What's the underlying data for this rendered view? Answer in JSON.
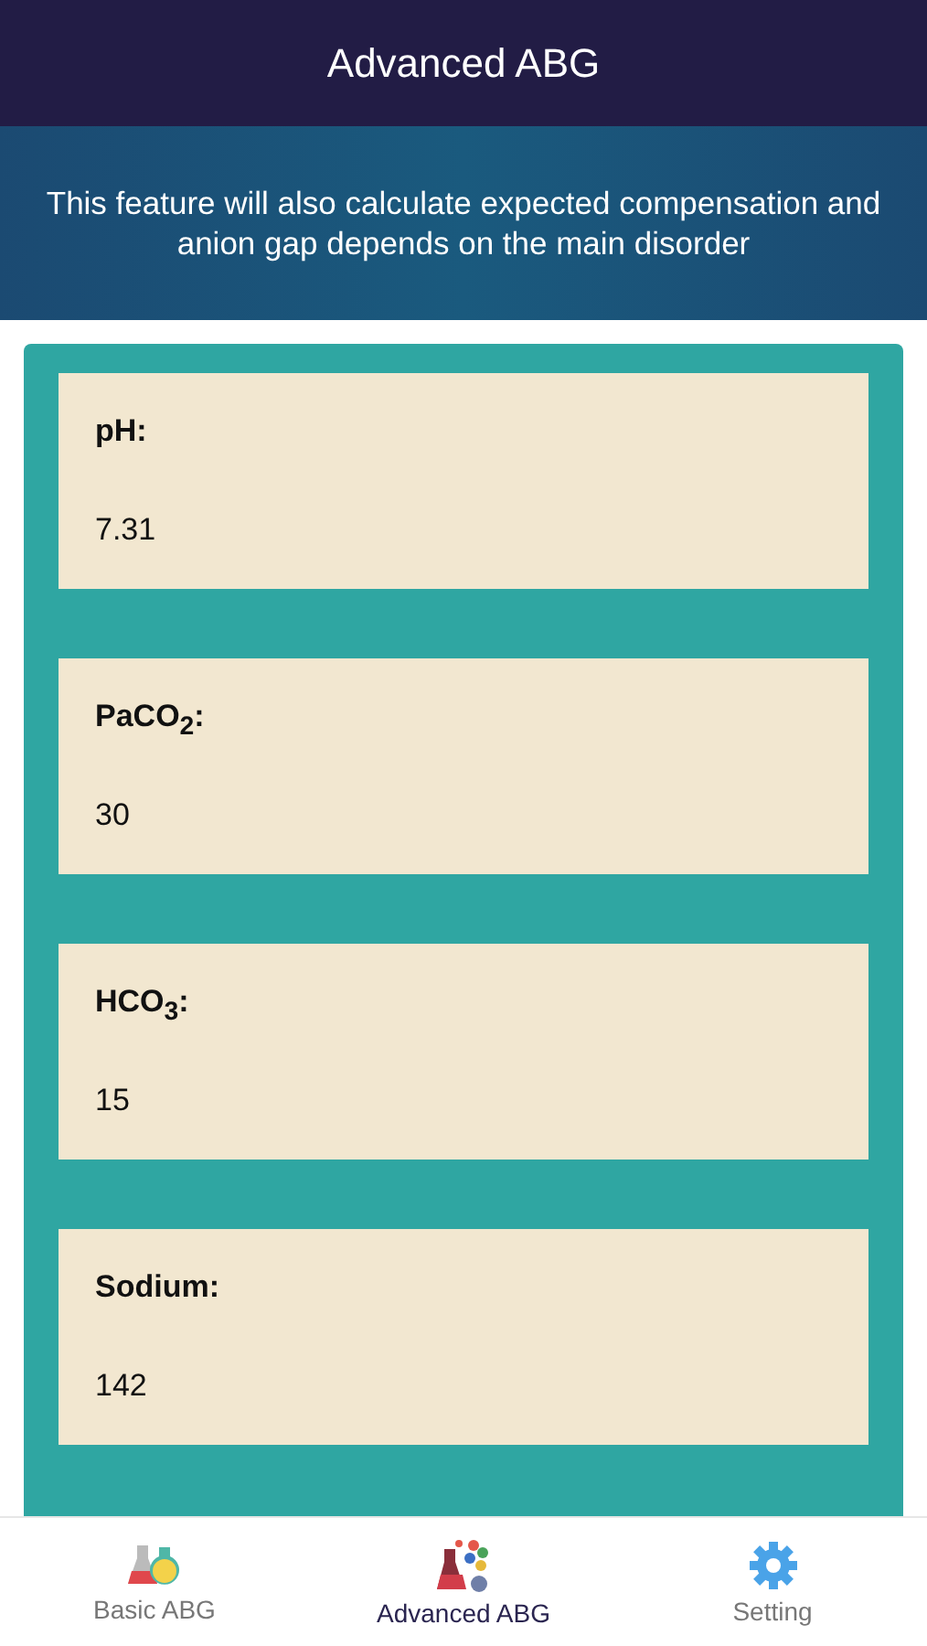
{
  "header": {
    "title": "Advanced ABG"
  },
  "banner": {
    "text": "This feature will also calculate expected compensation and anion gap depends on the main disorder"
  },
  "fields": [
    {
      "label": "pH:",
      "value": "7.31"
    },
    {
      "label": "PaCO$_{2}$:",
      "value": "30"
    },
    {
      "label": "HCO$_{3}$:",
      "value": "15"
    },
    {
      "label": "Sodium:",
      "value": "142"
    }
  ],
  "tab_bar": [
    {
      "kind": "flasks",
      "label": "Basic ABG",
      "selected": false
    },
    {
      "kind": "molecule",
      "label": "Advanced ABG",
      "selected": true
    },
    {
      "kind": "gear",
      "label": "Setting",
      "selected": false
    }
  ]
}
